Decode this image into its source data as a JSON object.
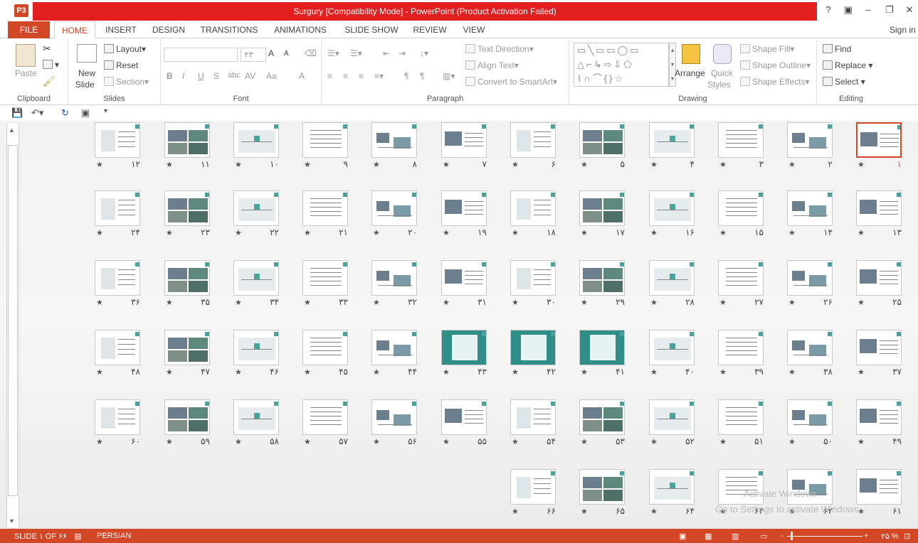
{
  "app": {
    "title": "Surgury [Compatibility Mode] -  PowerPoint (Product Activation Failed)",
    "logo": "P3",
    "help": "?",
    "sign_in": "Sign in"
  },
  "tabs": [
    "FILE",
    "HOME",
    "INSERT",
    "DESIGN",
    "TRANSITIONS",
    "ANIMATIONS",
    "SLIDE SHOW",
    "REVIEW",
    "VIEW"
  ],
  "ribbon": {
    "clipboard": {
      "paste": "Paste",
      "label": "Clipboard"
    },
    "slides": {
      "new_slide_1": "New",
      "new_slide_2": "Slide",
      "layout": "Layout",
      "reset": "Reset",
      "section": "Section",
      "label": "Slides"
    },
    "font": {
      "size": "۲۳",
      "bold": "B",
      "italic": "I",
      "underline": "U",
      "strike": "S",
      "shadow": "abc",
      "spacing": "AV",
      "case": "Aa",
      "color": "A",
      "grow": "A",
      "shrink": "A",
      "label": "Font"
    },
    "paragraph": {
      "text_direction": "Text Direction",
      "align_text": "Align Text",
      "smartart": "Convert to SmartArt",
      "label": "Paragraph"
    },
    "drawing": {
      "arrange": "Arrange",
      "quick_styles_1": "Quick",
      "quick_styles_2": "Styles",
      "shape_fill": "Shape Fill",
      "shape_outline": "Shape Outline",
      "shape_effects": "Shape Effects",
      "label": "Drawing"
    },
    "editing": {
      "find": "Find",
      "replace": "Replace",
      "select": "Select",
      "label": "Editing"
    }
  },
  "slides": {
    "numbers": [
      "۱",
      "۲",
      "۳",
      "۴",
      "۵",
      "۶",
      "۷",
      "۸",
      "۹",
      "۱۰",
      "۱۱",
      "۱۲",
      "۱۳",
      "۱۴",
      "۱۵",
      "۱۶",
      "۱۷",
      "۱۸",
      "۱۹",
      "۲۰",
      "۲۱",
      "۲۲",
      "۲۳",
      "۲۴",
      "۲۵",
      "۲۶",
      "۲۷",
      "۲۸",
      "۲۹",
      "۳۰",
      "۳۱",
      "۳۲",
      "۳۳",
      "۳۴",
      "۳۵",
      "۳۶",
      "۳۷",
      "۳۸",
      "۳۹",
      "۴۰",
      "۴۱",
      "۴۲",
      "۴۳",
      "۴۴",
      "۴۵",
      "۴۶",
      "۴۷",
      "۴۸",
      "۴۹",
      "۵۰",
      "۵۱",
      "۵۲",
      "۵۳",
      "۵۴",
      "۵۵",
      "۵۶",
      "۵۷",
      "۵۸",
      "۵۹",
      "۶۰",
      "۶۱",
      "۶۲",
      "۶۳",
      "۶۴",
      "۶۵",
      "۶۶"
    ],
    "selected": 1,
    "star": "★"
  },
  "watermark": {
    "line1": "Activate Windows",
    "line2": "Go to Settings to activate Windows."
  },
  "status": {
    "slide": "SLIDE ۱ OF ۶۶",
    "language": "PERSIAN",
    "zoom": "۲۵ %",
    "zoom_minus": "-",
    "zoom_plus": "+"
  },
  "colors": {
    "accent": "#d24726",
    "title_red": "#e31e1e",
    "teal": "#49a39c"
  }
}
